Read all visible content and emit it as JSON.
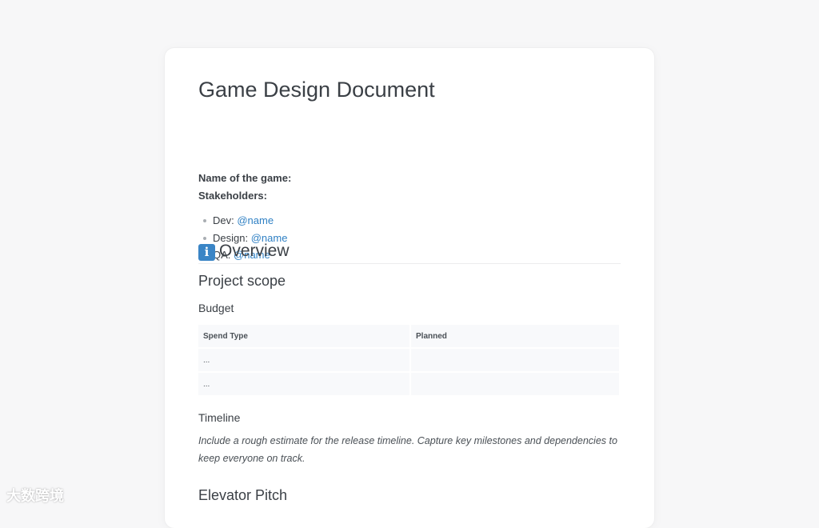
{
  "document": {
    "title": "Game Design Document",
    "name_label": "Name of the game:",
    "stakeholders_label": "Stakeholders:",
    "stakeholders": [
      {
        "role": "Dev: ",
        "mention": "@name"
      },
      {
        "role": "Design: ",
        "mention": "@name"
      },
      {
        "role": "QA: ",
        "mention": "@name"
      }
    ],
    "overview_heading": "Overview",
    "overview_icon": "info-icon",
    "project_scope_heading": "Project scope",
    "budget_heading": "Budget",
    "budget_table": {
      "headers": [
        "Spend Type",
        "Planned"
      ],
      "rows": [
        [
          "...",
          ""
        ],
        [
          "...",
          ""
        ]
      ]
    },
    "timeline_heading": "Timeline",
    "timeline_text": "Include a rough estimate for the release timeline. Capture key milestones and dependencies to keep everyone on track.",
    "elevator_pitch_heading": "Elevator Pitch"
  },
  "watermark": "大数跨境",
  "colors": {
    "mention": "#2f80c4",
    "info_icon_bg": "#3a85c6",
    "background": "#f7f7f8"
  }
}
